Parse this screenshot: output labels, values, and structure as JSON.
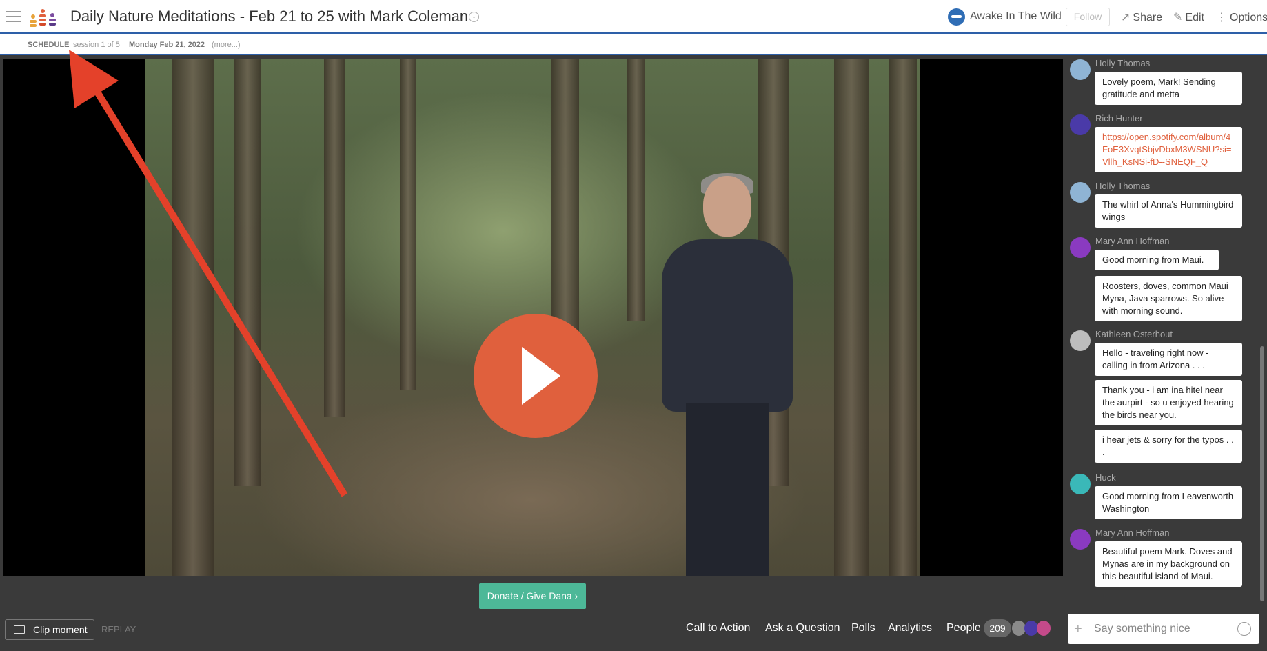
{
  "header": {
    "title": "Daily Nature Meditations - Feb 21 to 25 with Mark Coleman",
    "channel": "Awake In The Wild",
    "follow_label": "Follow",
    "share_label": "Share",
    "edit_label": "Edit",
    "options_label": "Options"
  },
  "schedule": {
    "label": "SCHEDULE",
    "session": "session 1 of 5",
    "date": "Monday Feb 21, 2022",
    "more": "(more...)"
  },
  "video": {
    "donate_label": "Donate / Give Dana ›"
  },
  "bottom_bar": {
    "clip_label": "Clip moment",
    "replay_label": "REPLAY",
    "tabs": [
      "Call to Action",
      "Ask a Question",
      "Polls",
      "Analytics",
      "People"
    ],
    "people_count": "209"
  },
  "chat": {
    "messages": [
      {
        "user": "Holly Thomas",
        "texts": [
          "Lovely poem, Mark! Sending gratitude and metta"
        ]
      },
      {
        "user": "Rich Hunter",
        "texts": [
          "https://open.spotify.com/album/4FoE3XvqtSbjvDbxM3WSNU?si=Vllh_KsNSi-fD--SNEQF_Q"
        ]
      },
      {
        "user": "Holly Thomas",
        "texts": [
          "The whirl of Anna's Hummingbird wings"
        ]
      },
      {
        "user": "Mary Ann Hoffman",
        "texts": [
          "Good morning from Maui.",
          "Roosters, doves, common Maui Myna, Java sparrows. So alive with morning sound."
        ]
      },
      {
        "user": "Kathleen Osterhout",
        "texts": [
          "Hello - traveling right now - calling in from Arizona . . .",
          "Thank you - i am ina hitel near the aurpirt - so u enjoyed hearing the birds near you.",
          "i hear jets & sorry for the typos . . ."
        ]
      },
      {
        "user": "Huck",
        "texts": [
          "Good morning from Leavenworth Washington"
        ]
      },
      {
        "user": "Mary Ann Hoffman",
        "texts": [
          "Beautiful poem Mark. Doves and Mynas are in my background on this beautiful island of Maui."
        ]
      }
    ],
    "input_placeholder": "Say something nice"
  }
}
